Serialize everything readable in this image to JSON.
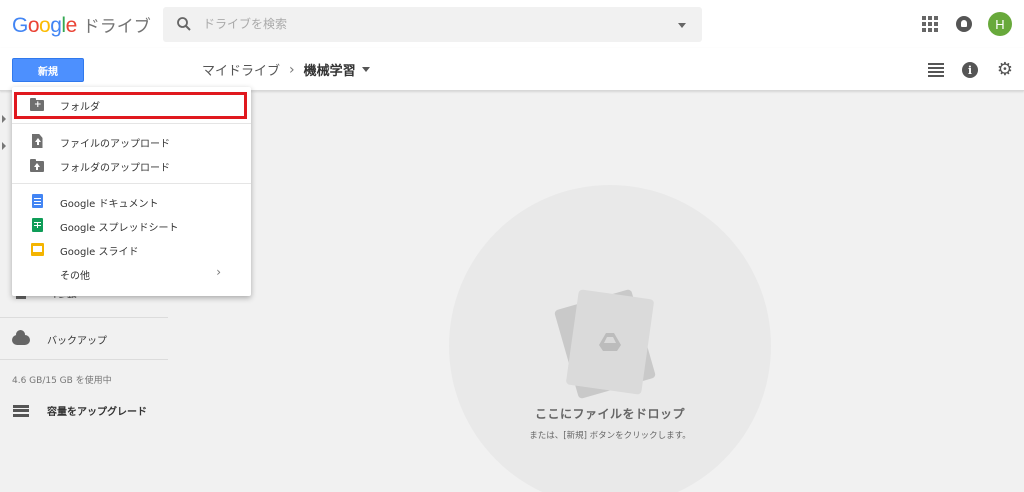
{
  "header": {
    "logo_word": "Google",
    "logo_colors": [
      "#4285f4",
      "#ea4335",
      "#fbbc05",
      "#4285f4",
      "#34a853",
      "#ea4335"
    ],
    "product_name": "ドライブ",
    "search_placeholder": "ドライブを検索",
    "avatar_initial": "H",
    "avatar_color": "#68a93b"
  },
  "toolbar": {
    "new_button_label": "新規",
    "breadcrumb": {
      "parent": "マイドライブ",
      "separator": "›",
      "current": "機械学習"
    },
    "icons": [
      "list-view-icon",
      "info-icon",
      "gear-icon"
    ]
  },
  "sidebar": {
    "trash_label": "ゴミ箱",
    "backup_label": "バックアップ",
    "storage_text": "4.6 GB/15 GB を使用中",
    "upgrade_label": "容量をアップグレード"
  },
  "new_menu": {
    "items": [
      {
        "label": "フォルダ",
        "icon": "new-folder-icon",
        "highlighted": true
      },
      {
        "label": "ファイルのアップロード",
        "icon": "file-upload-icon"
      },
      {
        "label": "フォルダのアップロード",
        "icon": "folder-upload-icon"
      },
      {
        "label": "Google ドキュメント",
        "icon": "google-docs-icon",
        "color": "#4285f4"
      },
      {
        "label": "Google スプレッドシート",
        "icon": "google-sheets-icon",
        "color": "#0f9d58"
      },
      {
        "label": "Google スライド",
        "icon": "google-slides-icon",
        "color": "#f4b400"
      },
      {
        "label": "その他",
        "icon": "chevron-right-icon",
        "has_submenu": true
      }
    ],
    "highlight_color": "#e0181e"
  },
  "empty_state": {
    "title": "ここにファイルをドロップ",
    "subtitle": "または、[新規] ボタンをクリックします。"
  }
}
